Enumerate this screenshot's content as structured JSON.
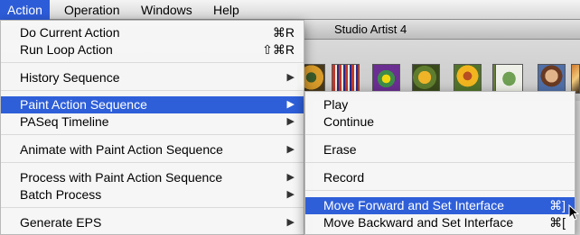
{
  "menubar": {
    "items": [
      "Action",
      "Operation",
      "Windows",
      "Help"
    ]
  },
  "window": {
    "title": "Studio Artist 4"
  },
  "action_menu": {
    "items": [
      {
        "label": "Do Current Action",
        "shortcut": "⌘R"
      },
      {
        "label": "Run Loop Action",
        "shortcut": "⇧⌘R"
      },
      {
        "label": "History Sequence",
        "submenu": "▶"
      },
      {
        "label": "Paint Action Sequence",
        "submenu": "▶"
      },
      {
        "label": "PASeq Timeline",
        "submenu": "▶"
      },
      {
        "label": "Animate with Paint Action Sequence",
        "submenu": "▶"
      },
      {
        "label": "Process with Paint Action Sequence",
        "submenu": "▶"
      },
      {
        "label": "Batch Process",
        "submenu": "▶"
      },
      {
        "label": "Generate EPS",
        "submenu": "▶"
      }
    ]
  },
  "submenu": {
    "items": [
      {
        "label": "Play"
      },
      {
        "label": "Continue"
      },
      {
        "label": "Erase"
      },
      {
        "label": "Record"
      },
      {
        "label": "Move Forward and Set Interface",
        "shortcut": "⌘]"
      },
      {
        "label": "Move Backward and Set Interface",
        "shortcut": "⌘["
      }
    ]
  }
}
